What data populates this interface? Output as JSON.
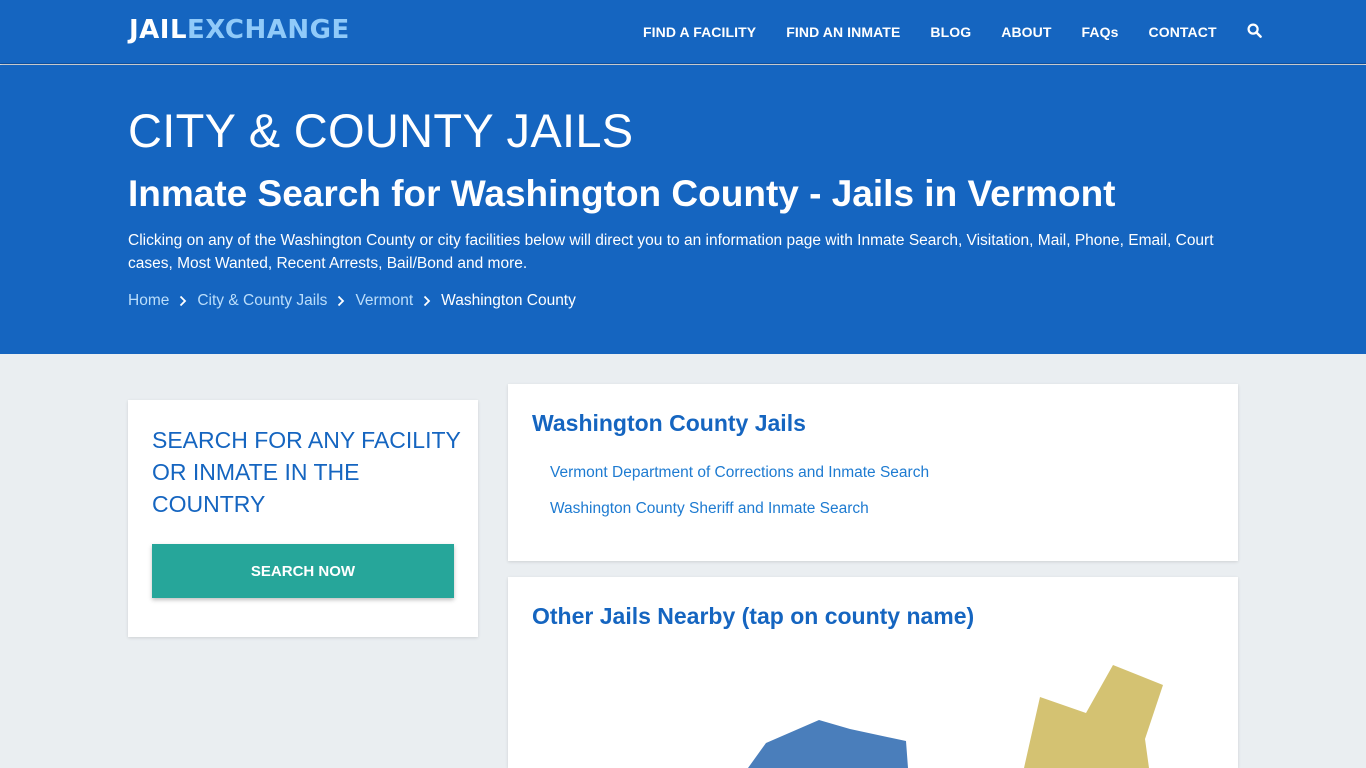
{
  "header": {
    "logo_part1": "JAIL",
    "logo_part2": "EXCHANGE",
    "nav": [
      {
        "label": "FIND A FACILITY"
      },
      {
        "label": "FIND AN INMATE"
      },
      {
        "label": "BLOG"
      },
      {
        "label": "ABOUT"
      },
      {
        "label": "FAQs"
      },
      {
        "label": "CONTACT"
      }
    ],
    "search_icon": "search-icon"
  },
  "hero": {
    "title": "CITY & COUNTY JAILS",
    "subtitle": "Inmate Search for Washington County - Jails in Vermont",
    "description": "Clicking on any of the Washington County or city facilities below will direct you to an information page with Inmate Search, Visitation, Mail, Phone, Email, Court cases, Most Wanted, Recent Arrests, Bail/Bond and more.",
    "breadcrumb": [
      {
        "label": "Home"
      },
      {
        "label": "City & County Jails"
      },
      {
        "label": "Vermont"
      },
      {
        "label": "Washington County"
      }
    ],
    "breadcrumb_separator_icon": "chevron-right-icon"
  },
  "search_card": {
    "title": "SEARCH FOR ANY FACILITY OR INMATE IN THE COUNTRY",
    "button_label": "SEARCH NOW"
  },
  "jails_card": {
    "title": "Washington County Jails",
    "links": [
      {
        "label": "Vermont Department of Corrections and Inmate Search"
      },
      {
        "label": "Washington County Sheriff and Inmate Search"
      }
    ]
  },
  "nearby_card": {
    "title": "Other Jails Nearby (tap on county name)",
    "map_colors": {
      "county_blue": "#4a7ebb",
      "county_yellow": "#d4c272"
    }
  },
  "colors": {
    "brand_blue": "#1565c0",
    "logo_accent": "#90caf9",
    "button_teal": "#26a69a",
    "page_bg": "#eaeef1"
  }
}
